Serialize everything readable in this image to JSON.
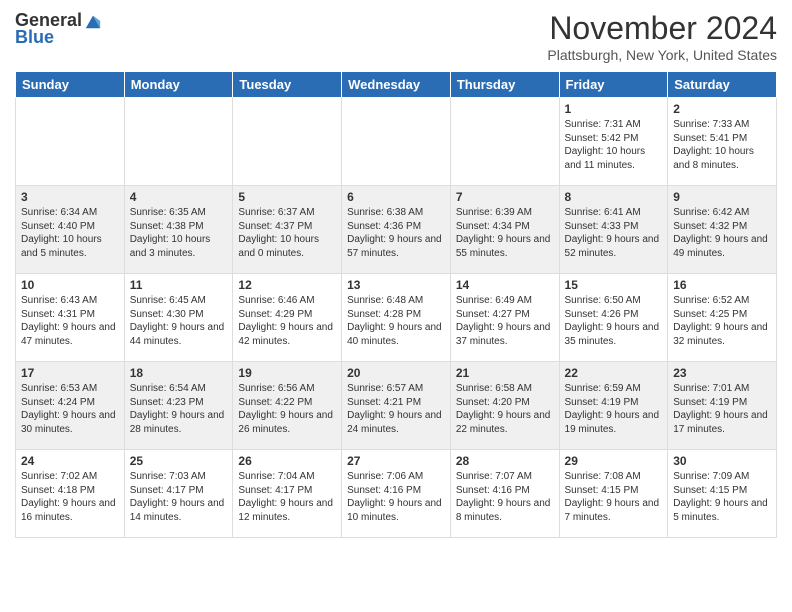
{
  "header": {
    "logo_general": "General",
    "logo_blue": "Blue",
    "month_title": "November 2024",
    "location": "Plattsburgh, New York, United States"
  },
  "days_of_week": [
    "Sunday",
    "Monday",
    "Tuesday",
    "Wednesday",
    "Thursday",
    "Friday",
    "Saturday"
  ],
  "weeks": [
    [
      {
        "day": "",
        "info": ""
      },
      {
        "day": "",
        "info": ""
      },
      {
        "day": "",
        "info": ""
      },
      {
        "day": "",
        "info": ""
      },
      {
        "day": "",
        "info": ""
      },
      {
        "day": "1",
        "info": "Sunrise: 7:31 AM\nSunset: 5:42 PM\nDaylight: 10 hours and 11 minutes."
      },
      {
        "day": "2",
        "info": "Sunrise: 7:33 AM\nSunset: 5:41 PM\nDaylight: 10 hours and 8 minutes."
      }
    ],
    [
      {
        "day": "3",
        "info": "Sunrise: 6:34 AM\nSunset: 4:40 PM\nDaylight: 10 hours and 5 minutes."
      },
      {
        "day": "4",
        "info": "Sunrise: 6:35 AM\nSunset: 4:38 PM\nDaylight: 10 hours and 3 minutes."
      },
      {
        "day": "5",
        "info": "Sunrise: 6:37 AM\nSunset: 4:37 PM\nDaylight: 10 hours and 0 minutes."
      },
      {
        "day": "6",
        "info": "Sunrise: 6:38 AM\nSunset: 4:36 PM\nDaylight: 9 hours and 57 minutes."
      },
      {
        "day": "7",
        "info": "Sunrise: 6:39 AM\nSunset: 4:34 PM\nDaylight: 9 hours and 55 minutes."
      },
      {
        "day": "8",
        "info": "Sunrise: 6:41 AM\nSunset: 4:33 PM\nDaylight: 9 hours and 52 minutes."
      },
      {
        "day": "9",
        "info": "Sunrise: 6:42 AM\nSunset: 4:32 PM\nDaylight: 9 hours and 49 minutes."
      }
    ],
    [
      {
        "day": "10",
        "info": "Sunrise: 6:43 AM\nSunset: 4:31 PM\nDaylight: 9 hours and 47 minutes."
      },
      {
        "day": "11",
        "info": "Sunrise: 6:45 AM\nSunset: 4:30 PM\nDaylight: 9 hours and 44 minutes."
      },
      {
        "day": "12",
        "info": "Sunrise: 6:46 AM\nSunset: 4:29 PM\nDaylight: 9 hours and 42 minutes."
      },
      {
        "day": "13",
        "info": "Sunrise: 6:48 AM\nSunset: 4:28 PM\nDaylight: 9 hours and 40 minutes."
      },
      {
        "day": "14",
        "info": "Sunrise: 6:49 AM\nSunset: 4:27 PM\nDaylight: 9 hours and 37 minutes."
      },
      {
        "day": "15",
        "info": "Sunrise: 6:50 AM\nSunset: 4:26 PM\nDaylight: 9 hours and 35 minutes."
      },
      {
        "day": "16",
        "info": "Sunrise: 6:52 AM\nSunset: 4:25 PM\nDaylight: 9 hours and 32 minutes."
      }
    ],
    [
      {
        "day": "17",
        "info": "Sunrise: 6:53 AM\nSunset: 4:24 PM\nDaylight: 9 hours and 30 minutes."
      },
      {
        "day": "18",
        "info": "Sunrise: 6:54 AM\nSunset: 4:23 PM\nDaylight: 9 hours and 28 minutes."
      },
      {
        "day": "19",
        "info": "Sunrise: 6:56 AM\nSunset: 4:22 PM\nDaylight: 9 hours and 26 minutes."
      },
      {
        "day": "20",
        "info": "Sunrise: 6:57 AM\nSunset: 4:21 PM\nDaylight: 9 hours and 24 minutes."
      },
      {
        "day": "21",
        "info": "Sunrise: 6:58 AM\nSunset: 4:20 PM\nDaylight: 9 hours and 22 minutes."
      },
      {
        "day": "22",
        "info": "Sunrise: 6:59 AM\nSunset: 4:19 PM\nDaylight: 9 hours and 19 minutes."
      },
      {
        "day": "23",
        "info": "Sunrise: 7:01 AM\nSunset: 4:19 PM\nDaylight: 9 hours and 17 minutes."
      }
    ],
    [
      {
        "day": "24",
        "info": "Sunrise: 7:02 AM\nSunset: 4:18 PM\nDaylight: 9 hours and 16 minutes."
      },
      {
        "day": "25",
        "info": "Sunrise: 7:03 AM\nSunset: 4:17 PM\nDaylight: 9 hours and 14 minutes."
      },
      {
        "day": "26",
        "info": "Sunrise: 7:04 AM\nSunset: 4:17 PM\nDaylight: 9 hours and 12 minutes."
      },
      {
        "day": "27",
        "info": "Sunrise: 7:06 AM\nSunset: 4:16 PM\nDaylight: 9 hours and 10 minutes."
      },
      {
        "day": "28",
        "info": "Sunrise: 7:07 AM\nSunset: 4:16 PM\nDaylight: 9 hours and 8 minutes."
      },
      {
        "day": "29",
        "info": "Sunrise: 7:08 AM\nSunset: 4:15 PM\nDaylight: 9 hours and 7 minutes."
      },
      {
        "day": "30",
        "info": "Sunrise: 7:09 AM\nSunset: 4:15 PM\nDaylight: 9 hours and 5 minutes."
      }
    ]
  ],
  "accent_color": "#2a6db5"
}
